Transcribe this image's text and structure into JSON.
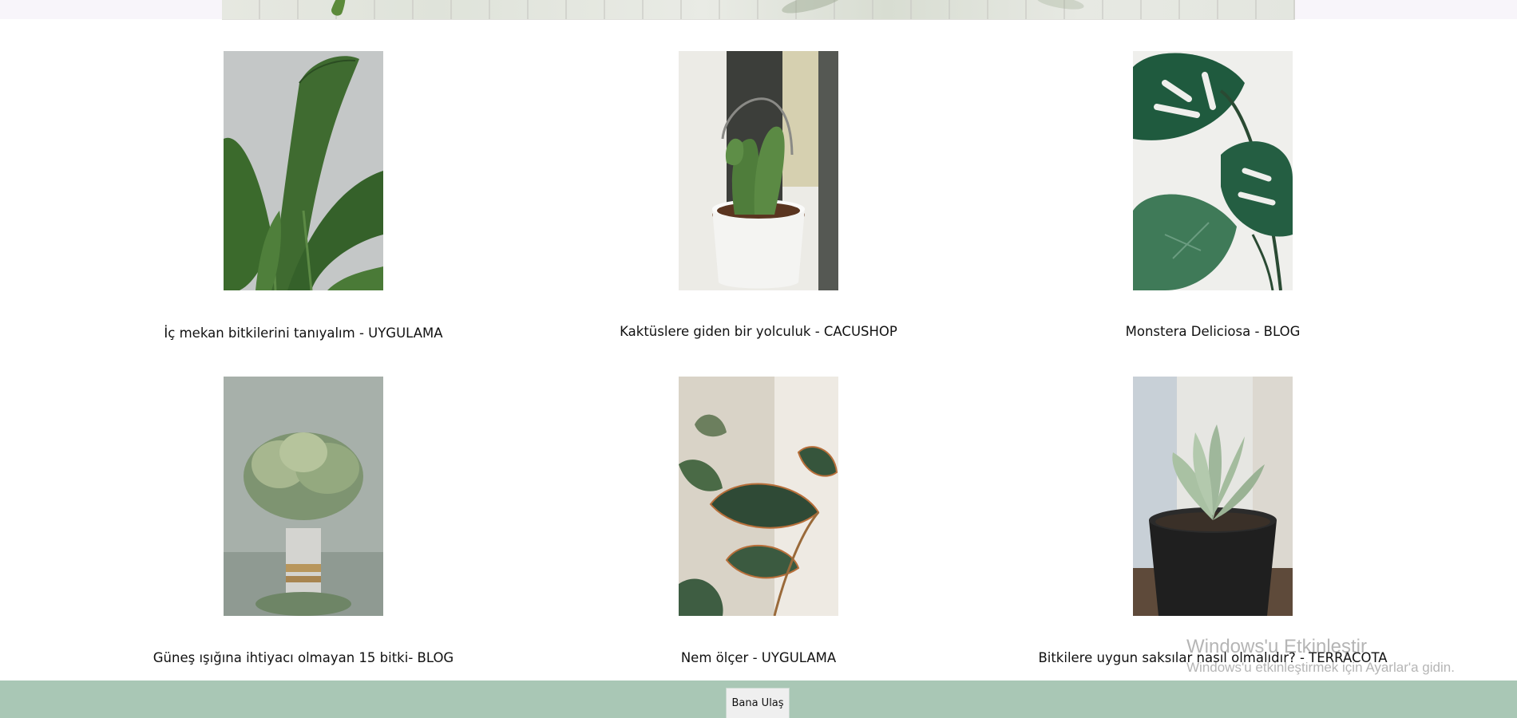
{
  "banner": {
    "alt": "plants banner"
  },
  "cards": [
    {
      "caption": "İç mekan bitkilerini tanıyalım - UYGULAMA",
      "photo": "banana-plant-leaves"
    },
    {
      "caption": "Kaktüslere giden bir yolculuk - CACUSHOP",
      "photo": "cactus-in-white-pot"
    },
    {
      "caption": "Monstera Deliciosa - BLOG",
      "photo": "monstera-leaves"
    },
    {
      "caption": "Güneş ışığına ihtiyacı olmayan 15 bitki- BLOG",
      "photo": "plant-in-striped-vase"
    },
    {
      "caption": "Nem ölçer - UYGULAMA",
      "photo": "leaves-closeup"
    },
    {
      "caption": "Bitkilere uygun saksılar nasıl olmalıdır? - TERRACOTA",
      "photo": "succulent-in-black-pot"
    }
  ],
  "footer": {
    "contact_label": "Bana Ulaş"
  },
  "watermark": {
    "title": "Windows'u Etkinleştir",
    "subtitle": "Windows'u etkinleştirmek için Ayarlar'a gidin."
  },
  "colors": {
    "footer_bg": "#a9c7b5",
    "page_bg": "#ffffff"
  }
}
